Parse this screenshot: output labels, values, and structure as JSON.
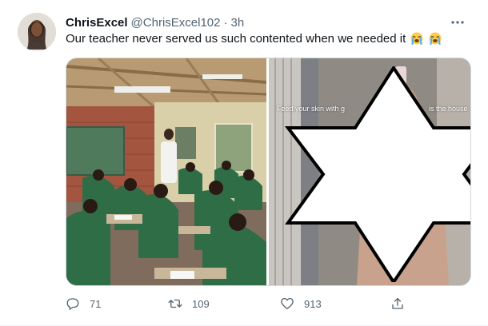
{
  "tweet": {
    "display_name": "ChrisExcel",
    "handle": "@ChrisExcel102",
    "separator": "·",
    "time": "3h",
    "text": "Our teacher never served us such contented when we needed it",
    "emoji_icon": "loudly-crying-face-icon"
  },
  "media": {
    "right_overlay_left": "Feed your skin with g",
    "right_overlay_right": "is the house"
  },
  "actions": {
    "reply_count": "71",
    "retweet_count": "109",
    "like_count": "913",
    "reply_icon": "reply-icon",
    "retweet_icon": "retweet-icon",
    "like_icon": "heart-icon",
    "share_icon": "share-icon"
  },
  "colors": {
    "text_primary": "#0f1419",
    "text_secondary": "#536471",
    "border": "#cfd9de"
  }
}
